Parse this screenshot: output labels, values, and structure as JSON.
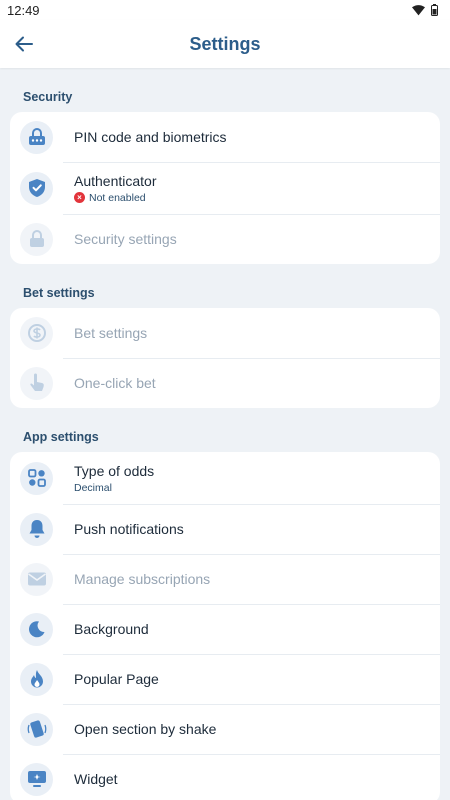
{
  "status_bar": {
    "time": "12:49"
  },
  "header": {
    "title": "Settings"
  },
  "colors": {
    "accent": "#4a84c4",
    "icon_bg": "#e9eff6",
    "error": "#e2343b",
    "section_text": "#2c4f6e"
  },
  "sections": {
    "security": {
      "title": "Security",
      "items": [
        {
          "label": "PIN code and biometrics",
          "icon": "pin-lock-icon",
          "enabled": true
        },
        {
          "label": "Authenticator",
          "subtitle": "Not enabled",
          "icon": "shield-check-icon",
          "enabled": true
        },
        {
          "label": "Security settings",
          "icon": "lock-icon",
          "enabled": false
        }
      ]
    },
    "bet": {
      "title": "Bet settings",
      "items": [
        {
          "label": "Bet settings",
          "icon": "dollar-coin-icon",
          "enabled": false
        },
        {
          "label": "One-click bet",
          "icon": "tap-hand-icon",
          "enabled": false
        }
      ]
    },
    "app": {
      "title": "App settings",
      "items": [
        {
          "label": "Type of odds",
          "subtitle": "Decimal",
          "icon": "grid-icon",
          "enabled": true
        },
        {
          "label": "Push notifications",
          "icon": "bell-icon",
          "enabled": true
        },
        {
          "label": "Manage subscriptions",
          "icon": "mail-icon",
          "enabled": false
        },
        {
          "label": "Background",
          "icon": "moon-icon",
          "enabled": true
        },
        {
          "label": "Popular Page",
          "icon": "flame-icon",
          "enabled": true
        },
        {
          "label": "Open section by shake",
          "icon": "shake-phone-icon",
          "enabled": true
        },
        {
          "label": "Widget",
          "icon": "widget-icon",
          "enabled": true
        }
      ]
    }
  }
}
